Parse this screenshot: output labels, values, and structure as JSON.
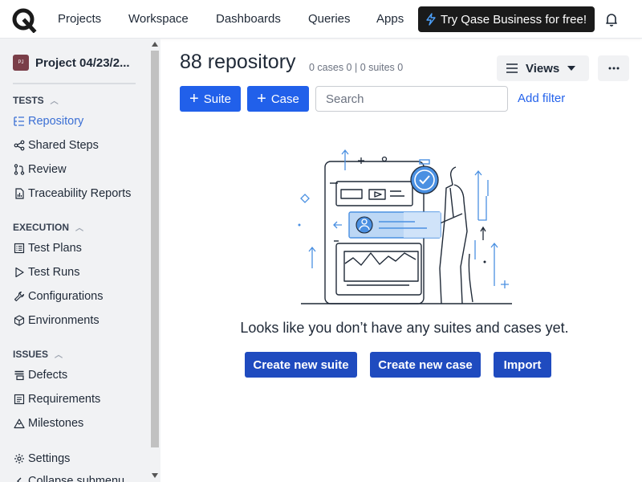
{
  "topbar": {
    "nav": [
      "Projects",
      "Workspace",
      "Dashboards",
      "Queries",
      "Apps"
    ],
    "promo_label": "Try Qase Business for free!"
  },
  "sidebar": {
    "project_avatar": "PJ",
    "project_name": "Project 04/23/2...",
    "sections": {
      "tests": "TESTS",
      "execution": "EXECUTION",
      "issues": "ISSUES"
    },
    "items": {
      "repository": "Repository",
      "shared_steps": "Shared Steps",
      "review": "Review",
      "traceability": "Traceability Reports",
      "test_plans": "Test Plans",
      "test_runs": "Test Runs",
      "configurations": "Configurations",
      "environments": "Environments",
      "defects": "Defects",
      "requirements": "Requirements",
      "milestones": "Milestones",
      "settings": "Settings",
      "collapse": "Collapse submenu"
    }
  },
  "main": {
    "title": "88 repository",
    "counts": "0 cases 0 | 0 suites 0",
    "views_label": "Views",
    "suite_label": "Suite",
    "case_label": "Case",
    "search_placeholder": "Search",
    "add_filter": "Add filter",
    "empty_message": "Looks like you don’t have any suites and cases yet.",
    "create_suite": "Create new suite",
    "create_case": "Create new case",
    "import": "Import"
  },
  "colors": {
    "primary": "#2160ea",
    "primary_dark": "#1f4bbf",
    "active_link": "#3b6fd4",
    "sidebar_bg": "#f1f2f4"
  }
}
